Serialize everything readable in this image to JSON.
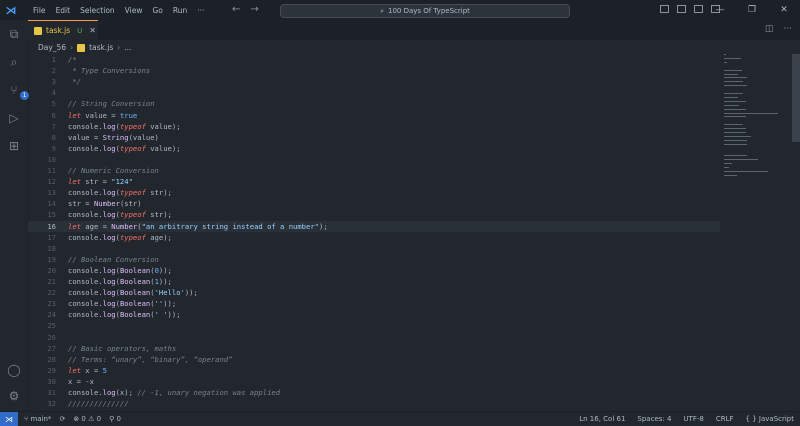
{
  "app": {
    "menu": [
      "File",
      "Edit",
      "Selection",
      "View",
      "Go",
      "Run",
      "···"
    ],
    "search_text": "100 Days Of TypeScript"
  },
  "tab": {
    "label": "task.js",
    "status": "U",
    "close": "✕"
  },
  "breadcrumbs": {
    "folder": "Day_56",
    "file": "task.js",
    "more": "..."
  },
  "activity": {
    "scm_badge": "1"
  },
  "editor": {
    "current_line": 16,
    "lines": [
      {
        "n": "1",
        "tokens": [
          {
            "t": "/*",
            "c": "cm"
          }
        ]
      },
      {
        "n": "2",
        "tokens": [
          {
            "t": " * Type Conversions",
            "c": "cm"
          }
        ]
      },
      {
        "n": "3",
        "tokens": [
          {
            "t": " */",
            "c": "cm"
          }
        ]
      },
      {
        "n": "4",
        "tokens": []
      },
      {
        "n": "5",
        "tokens": [
          {
            "t": "// String Conversion",
            "c": "cm"
          }
        ]
      },
      {
        "n": "6",
        "tokens": [
          {
            "t": "let",
            "c": "kw"
          },
          {
            "t": " value = ",
            "c": "id"
          },
          {
            "t": "true",
            "c": "num"
          }
        ]
      },
      {
        "n": "7",
        "tokens": [
          {
            "t": "console",
            "c": "id"
          },
          {
            "t": ".",
            "c": "id"
          },
          {
            "t": "log",
            "c": "fn"
          },
          {
            "t": "(",
            "c": "id"
          },
          {
            "t": "typeof",
            "c": "kw"
          },
          {
            "t": " value);",
            "c": "id"
          }
        ]
      },
      {
        "n": "8",
        "tokens": [
          {
            "t": "value = ",
            "c": "id"
          },
          {
            "t": "String",
            "c": "fn"
          },
          {
            "t": "(value)",
            "c": "id"
          }
        ]
      },
      {
        "n": "9",
        "tokens": [
          {
            "t": "console",
            "c": "id"
          },
          {
            "t": ".",
            "c": "id"
          },
          {
            "t": "log",
            "c": "fn"
          },
          {
            "t": "(",
            "c": "id"
          },
          {
            "t": "typeof",
            "c": "kw"
          },
          {
            "t": " value);",
            "c": "id"
          }
        ]
      },
      {
        "n": "10",
        "tokens": []
      },
      {
        "n": "11",
        "tokens": [
          {
            "t": "// Numeric Conversion",
            "c": "cm"
          }
        ]
      },
      {
        "n": "12",
        "tokens": [
          {
            "t": "let",
            "c": "kw"
          },
          {
            "t": " str = ",
            "c": "id"
          },
          {
            "t": "\"124\"",
            "c": "str"
          }
        ]
      },
      {
        "n": "13",
        "tokens": [
          {
            "t": "console",
            "c": "id"
          },
          {
            "t": ".",
            "c": "id"
          },
          {
            "t": "log",
            "c": "fn"
          },
          {
            "t": "(",
            "c": "id"
          },
          {
            "t": "typeof",
            "c": "kw"
          },
          {
            "t": " str);",
            "c": "id"
          }
        ]
      },
      {
        "n": "14",
        "tokens": [
          {
            "t": "str = ",
            "c": "id"
          },
          {
            "t": "Number",
            "c": "fn"
          },
          {
            "t": "(str)",
            "c": "id"
          }
        ]
      },
      {
        "n": "15",
        "tokens": [
          {
            "t": "console",
            "c": "id"
          },
          {
            "t": ".",
            "c": "id"
          },
          {
            "t": "log",
            "c": "fn"
          },
          {
            "t": "(",
            "c": "id"
          },
          {
            "t": "typeof",
            "c": "kw"
          },
          {
            "t": " str);",
            "c": "id"
          }
        ]
      },
      {
        "n": "16",
        "tokens": [
          {
            "t": "let",
            "c": "kw"
          },
          {
            "t": " age = ",
            "c": "id"
          },
          {
            "t": "Number",
            "c": "fn"
          },
          {
            "t": "(",
            "c": "id"
          },
          {
            "t": "\"an arbitrary string instead of a number\"",
            "c": "str"
          },
          {
            "t": ");",
            "c": "id"
          }
        ]
      },
      {
        "n": "17",
        "tokens": [
          {
            "t": "console",
            "c": "id"
          },
          {
            "t": ".",
            "c": "id"
          },
          {
            "t": "log",
            "c": "fn"
          },
          {
            "t": "(",
            "c": "id"
          },
          {
            "t": "typeof",
            "c": "kw"
          },
          {
            "t": " age);",
            "c": "id"
          }
        ]
      },
      {
        "n": "18",
        "tokens": []
      },
      {
        "n": "19",
        "tokens": [
          {
            "t": "// Boolean Conversion",
            "c": "cm"
          }
        ]
      },
      {
        "n": "20",
        "tokens": [
          {
            "t": "console",
            "c": "id"
          },
          {
            "t": ".",
            "c": "id"
          },
          {
            "t": "log",
            "c": "fn"
          },
          {
            "t": "(",
            "c": "id"
          },
          {
            "t": "Boolean",
            "c": "fn"
          },
          {
            "t": "(",
            "c": "id"
          },
          {
            "t": "0",
            "c": "num"
          },
          {
            "t": "));",
            "c": "id"
          }
        ]
      },
      {
        "n": "21",
        "tokens": [
          {
            "t": "console",
            "c": "id"
          },
          {
            "t": ".",
            "c": "id"
          },
          {
            "t": "log",
            "c": "fn"
          },
          {
            "t": "(",
            "c": "id"
          },
          {
            "t": "Boolean",
            "c": "fn"
          },
          {
            "t": "(",
            "c": "id"
          },
          {
            "t": "1",
            "c": "num"
          },
          {
            "t": "));",
            "c": "id"
          }
        ]
      },
      {
        "n": "22",
        "tokens": [
          {
            "t": "console",
            "c": "id"
          },
          {
            "t": ".",
            "c": "id"
          },
          {
            "t": "log",
            "c": "fn"
          },
          {
            "t": "(",
            "c": "id"
          },
          {
            "t": "Boolean",
            "c": "fn"
          },
          {
            "t": "(",
            "c": "id"
          },
          {
            "t": "'Hello'",
            "c": "str"
          },
          {
            "t": "));",
            "c": "id"
          }
        ]
      },
      {
        "n": "23",
        "tokens": [
          {
            "t": "console",
            "c": "id"
          },
          {
            "t": ".",
            "c": "id"
          },
          {
            "t": "log",
            "c": "fn"
          },
          {
            "t": "(",
            "c": "id"
          },
          {
            "t": "Boolean",
            "c": "fn"
          },
          {
            "t": "(",
            "c": "id"
          },
          {
            "t": "''",
            "c": "str"
          },
          {
            "t": "));",
            "c": "id"
          }
        ]
      },
      {
        "n": "24",
        "tokens": [
          {
            "t": "console",
            "c": "id"
          },
          {
            "t": ".",
            "c": "id"
          },
          {
            "t": "log",
            "c": "fn"
          },
          {
            "t": "(",
            "c": "id"
          },
          {
            "t": "Boolean",
            "c": "fn"
          },
          {
            "t": "(",
            "c": "id"
          },
          {
            "t": "' '",
            "c": "str"
          },
          {
            "t": "));",
            "c": "id"
          }
        ]
      },
      {
        "n": "25",
        "tokens": []
      },
      {
        "n": "26",
        "tokens": []
      },
      {
        "n": "27",
        "tokens": [
          {
            "t": "// Basic operators, maths",
            "c": "cm"
          }
        ]
      },
      {
        "n": "28",
        "tokens": [
          {
            "t": "// Terms: “unary”, “binary”, “operand”",
            "c": "cm"
          }
        ]
      },
      {
        "n": "29",
        "tokens": [
          {
            "t": "let",
            "c": "kw"
          },
          {
            "t": " x = ",
            "c": "id"
          },
          {
            "t": "5",
            "c": "num"
          }
        ]
      },
      {
        "n": "30",
        "tokens": [
          {
            "t": "x = -x",
            "c": "id"
          }
        ]
      },
      {
        "n": "31",
        "tokens": [
          {
            "t": "console",
            "c": "id"
          },
          {
            "t": ".",
            "c": "id"
          },
          {
            "t": "log",
            "c": "fn"
          },
          {
            "t": "(x); ",
            "c": "id"
          },
          {
            "t": "// -1, unary negation was applied",
            "c": "cm"
          }
        ]
      },
      {
        "n": "32",
        "tokens": [
          {
            "t": "//////////////",
            "c": "cm"
          }
        ]
      }
    ]
  },
  "status": {
    "branch": "main*",
    "errors": "0",
    "warnings": "0",
    "ports": "0",
    "position": "Ln 16, Col 61",
    "spaces": "Spaces: 4",
    "encoding": "UTF-8",
    "eol": "CRLF",
    "language": "JavaScript"
  },
  "colors": {
    "accent": "#316dca",
    "tab_accent": "#f69d50",
    "background": "#22272e"
  }
}
